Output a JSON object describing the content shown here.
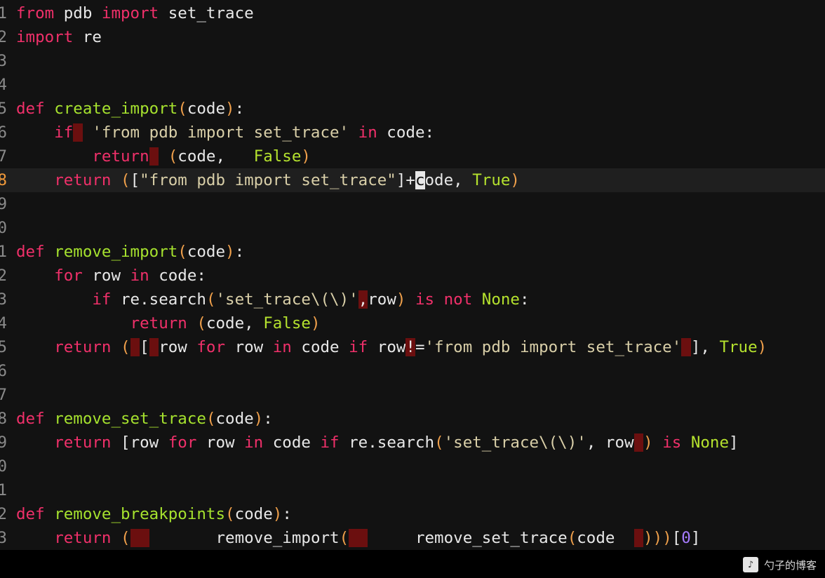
{
  "lines": [
    {
      "num": "1",
      "tokens": [
        [
          "kw",
          "from"
        ],
        [
          "tx",
          " pdb "
        ],
        [
          "kw",
          "import"
        ],
        [
          "tx",
          " set_trace"
        ]
      ]
    },
    {
      "num": "2",
      "tokens": [
        [
          "kw",
          "import"
        ],
        [
          "tx",
          " re"
        ]
      ]
    },
    {
      "num": "3",
      "tokens": []
    },
    {
      "num": "4",
      "tokens": []
    },
    {
      "num": "5",
      "tokens": [
        [
          "kw",
          "def"
        ],
        [
          "tx",
          " "
        ],
        [
          "fn",
          "create_import"
        ],
        [
          "par",
          "("
        ],
        [
          "tx",
          "code"
        ],
        [
          "par",
          ")"
        ],
        [
          "tx",
          ":"
        ]
      ]
    },
    {
      "num": "6",
      "tokens": [
        [
          "tx",
          "    "
        ],
        [
          "kw",
          "if"
        ],
        [
          "err",
          " "
        ],
        [
          "tx",
          " "
        ],
        [
          "str",
          "'from pdb import set_trace'"
        ],
        [
          "tx",
          " "
        ],
        [
          "kw",
          "in"
        ],
        [
          "tx",
          " code:"
        ]
      ]
    },
    {
      "num": "7",
      "tokens": [
        [
          "tx",
          "        "
        ],
        [
          "kw",
          "return"
        ],
        [
          "err",
          " "
        ],
        [
          "tx",
          " "
        ],
        [
          "par",
          "("
        ],
        [
          "tx",
          "code,   "
        ],
        [
          "bool",
          "False"
        ],
        [
          "par",
          ")"
        ]
      ]
    },
    {
      "num": "8",
      "current": true,
      "tokens": [
        [
          "tx",
          "    "
        ],
        [
          "kw",
          "return"
        ],
        [
          "tx",
          " "
        ],
        [
          "par",
          "("
        ],
        [
          "brk",
          "["
        ],
        [
          "str",
          "\"from pdb import set_trace\""
        ],
        [
          "brk",
          "]"
        ],
        [
          "tx",
          "+"
        ],
        [
          "cur",
          "c"
        ],
        [
          "tx",
          "ode, "
        ],
        [
          "bool",
          "True"
        ],
        [
          "par",
          ")"
        ]
      ]
    },
    {
      "num": "9",
      "tokens": []
    },
    {
      "num": "0",
      "tokens": []
    },
    {
      "num": "1",
      "tokens": [
        [
          "kw",
          "def"
        ],
        [
          "tx",
          " "
        ],
        [
          "fn",
          "remove_import"
        ],
        [
          "par",
          "("
        ],
        [
          "tx",
          "code"
        ],
        [
          "par",
          ")"
        ],
        [
          "tx",
          ":"
        ]
      ]
    },
    {
      "num": "2",
      "tokens": [
        [
          "tx",
          "    "
        ],
        [
          "kw",
          "for"
        ],
        [
          "tx",
          " row "
        ],
        [
          "kw",
          "in"
        ],
        [
          "tx",
          " code:"
        ]
      ]
    },
    {
      "num": "3",
      "tokens": [
        [
          "tx",
          "        "
        ],
        [
          "kw",
          "if"
        ],
        [
          "tx",
          " re.search"
        ],
        [
          "par",
          "("
        ],
        [
          "str",
          "'set_trace\\(\\)'"
        ],
        [
          "err",
          ","
        ],
        [
          "tx",
          "row"
        ],
        [
          "par",
          ")"
        ],
        [
          "tx",
          " "
        ],
        [
          "kw",
          "is not"
        ],
        [
          "tx",
          " "
        ],
        [
          "bool",
          "None"
        ],
        [
          "tx",
          ":"
        ]
      ]
    },
    {
      "num": "4",
      "tokens": [
        [
          "tx",
          "            "
        ],
        [
          "kw",
          "return"
        ],
        [
          "tx",
          " "
        ],
        [
          "par",
          "("
        ],
        [
          "tx",
          "code, "
        ],
        [
          "bool",
          "False"
        ],
        [
          "par",
          ")"
        ]
      ]
    },
    {
      "num": "5",
      "tokens": [
        [
          "tx",
          "    "
        ],
        [
          "kw",
          "return"
        ],
        [
          "tx",
          " "
        ],
        [
          "par",
          "("
        ],
        [
          "err",
          " "
        ],
        [
          "brk",
          "["
        ],
        [
          "err",
          " "
        ],
        [
          "tx",
          "row "
        ],
        [
          "kw",
          "for"
        ],
        [
          "tx",
          " row "
        ],
        [
          "kw",
          "in"
        ],
        [
          "tx",
          " code "
        ],
        [
          "kw",
          "if"
        ],
        [
          "tx",
          " row"
        ],
        [
          "err",
          "!"
        ],
        [
          "tx",
          "="
        ],
        [
          "str",
          "'from pdb import set_trace'"
        ],
        [
          "err",
          " "
        ],
        [
          "brk",
          "]"
        ],
        [
          "tx",
          ", "
        ],
        [
          "bool",
          "True"
        ],
        [
          "par",
          ")"
        ]
      ]
    },
    {
      "num": "6",
      "tokens": []
    },
    {
      "num": "7",
      "tokens": []
    },
    {
      "num": "8",
      "tokens": [
        [
          "kw",
          "def"
        ],
        [
          "tx",
          " "
        ],
        [
          "fn",
          "remove_set_trace"
        ],
        [
          "par",
          "("
        ],
        [
          "tx",
          "code"
        ],
        [
          "par",
          ")"
        ],
        [
          "tx",
          ":"
        ]
      ]
    },
    {
      "num": "9",
      "tokens": [
        [
          "tx",
          "    "
        ],
        [
          "kw",
          "return"
        ],
        [
          "tx",
          " "
        ],
        [
          "brk",
          "["
        ],
        [
          "tx",
          "row "
        ],
        [
          "kw",
          "for"
        ],
        [
          "tx",
          " row "
        ],
        [
          "kw",
          "in"
        ],
        [
          "tx",
          " code "
        ],
        [
          "kw",
          "if"
        ],
        [
          "tx",
          " re.search"
        ],
        [
          "par",
          "("
        ],
        [
          "str",
          "'set_trace\\(\\)'"
        ],
        [
          "tx",
          ", row"
        ],
        [
          "err",
          " "
        ],
        [
          "par",
          ")"
        ],
        [
          "tx",
          " "
        ],
        [
          "kw",
          "is"
        ],
        [
          "tx",
          " "
        ],
        [
          "bool",
          "None"
        ],
        [
          "brk",
          "]"
        ]
      ]
    },
    {
      "num": "0",
      "tokens": []
    },
    {
      "num": "1",
      "tokens": []
    },
    {
      "num": "2",
      "tokens": [
        [
          "kw",
          "def"
        ],
        [
          "tx",
          " "
        ],
        [
          "fn",
          "remove_breakpoints"
        ],
        [
          "par",
          "("
        ],
        [
          "tx",
          "code"
        ],
        [
          "par",
          ")"
        ],
        [
          "tx",
          ":"
        ]
      ]
    },
    {
      "num": "3",
      "tokens": [
        [
          "tx",
          "    "
        ],
        [
          "kw",
          "return"
        ],
        [
          "tx",
          " "
        ],
        [
          "par",
          "("
        ],
        [
          "err",
          "  "
        ],
        [
          "tx",
          "       remove_import"
        ],
        [
          "par",
          "("
        ],
        [
          "err",
          "  "
        ],
        [
          "tx",
          "     remove_set_trace"
        ],
        [
          "par",
          "("
        ],
        [
          "tx",
          "code  "
        ],
        [
          "err",
          " "
        ],
        [
          "par",
          ")"
        ],
        [
          "par",
          ")"
        ],
        [
          "par",
          ")"
        ],
        [
          "brk",
          "["
        ],
        [
          "num",
          "0"
        ],
        [
          "brk",
          "]"
        ]
      ]
    }
  ],
  "watermark": {
    "icon": "music-note-icon",
    "glyph": "♪",
    "text": "勺子的博客"
  }
}
